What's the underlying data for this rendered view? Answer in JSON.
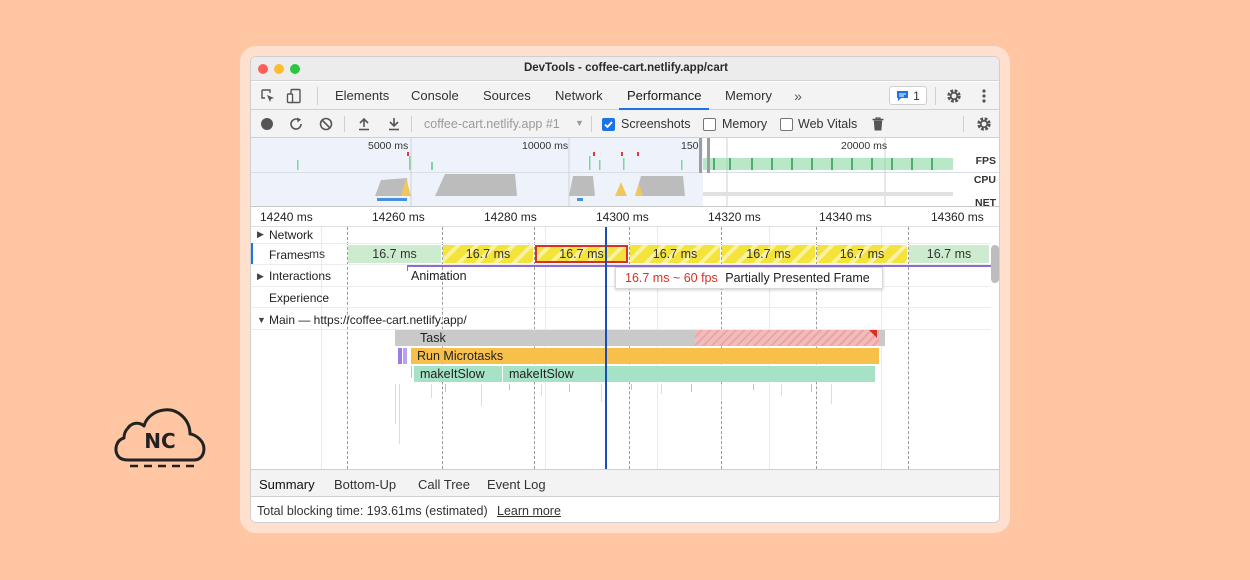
{
  "window": {
    "title": "DevTools - coffee-cart.netlify.app/cart",
    "traffic_lights": [
      "#FF5F57",
      "#FEBC2E",
      "#28C840"
    ]
  },
  "logo": {
    "text": "NC",
    "icon": "cloud-icon"
  },
  "tabs": [
    "Elements",
    "Console",
    "Sources",
    "Network",
    "Performance",
    "Memory"
  ],
  "active_tab": "Performance",
  "issues_badge": {
    "count": "1",
    "icon": "message-icon"
  },
  "toolbar": {
    "profile_select": "coffee-cart.netlify.app #1",
    "checkboxes": [
      {
        "label": "Screenshots",
        "checked": true
      },
      {
        "label": "Memory",
        "checked": false
      },
      {
        "label": "Web Vitals",
        "checked": false
      }
    ]
  },
  "overview": {
    "time_labels": [
      "5000 ms",
      "10000 ms",
      "150",
      "20000 ms"
    ],
    "track_labels": [
      "FPS",
      "CPU",
      "NET"
    ]
  },
  "ruler": {
    "ticks": [
      "14240 ms",
      "14260 ms",
      "14280 ms",
      "14300 ms",
      "14320 ms",
      "14340 ms",
      "14360 ms"
    ]
  },
  "tracks": {
    "network": "Network",
    "frames": "Frames",
    "frames_cut": "ms",
    "interactions": "Interactions",
    "interaction_animation": "Animation",
    "experience": "Experience",
    "main": "Main — https://coffee-cart.netlify.app/"
  },
  "frames": [
    {
      "label": "16.7 ms",
      "type": "green"
    },
    {
      "label": "16.7 ms",
      "type": "yellow"
    },
    {
      "label": "16.7 ms",
      "type": "yellow",
      "selected": true
    },
    {
      "label": "16.7 ms",
      "type": "yellow"
    },
    {
      "label": "16.7 ms",
      "type": "yellow"
    },
    {
      "label": "16.7 ms",
      "type": "yellow"
    },
    {
      "label": "16.7 ms",
      "type": "green"
    }
  ],
  "tooltip": {
    "fps_text": "16.7 ms ~ 60 fps",
    "description": "Partially Presented Frame"
  },
  "flame": {
    "task": "Task",
    "microtasks": "Run Microtasks",
    "make_slow_1": "makeItSlow",
    "make_slow_2": "makeItSlow"
  },
  "bottom_tabs": [
    "Summary",
    "Bottom-Up",
    "Call Tree",
    "Event Log"
  ],
  "status": {
    "text": "Total blocking time: 193.61ms (estimated)",
    "link": "Learn more"
  },
  "colors": {
    "background": "#FFC6A4",
    "accent": "#1a73e8",
    "task": "#c8c8c8",
    "long_task": "#f1b9b9",
    "microtasks": "#f7c04a",
    "js_call": "#a6e3c6",
    "fps_green": "#7ed69a",
    "cpu_yellow": "#f0c75c",
    "tooltip_red": "#d93025"
  }
}
